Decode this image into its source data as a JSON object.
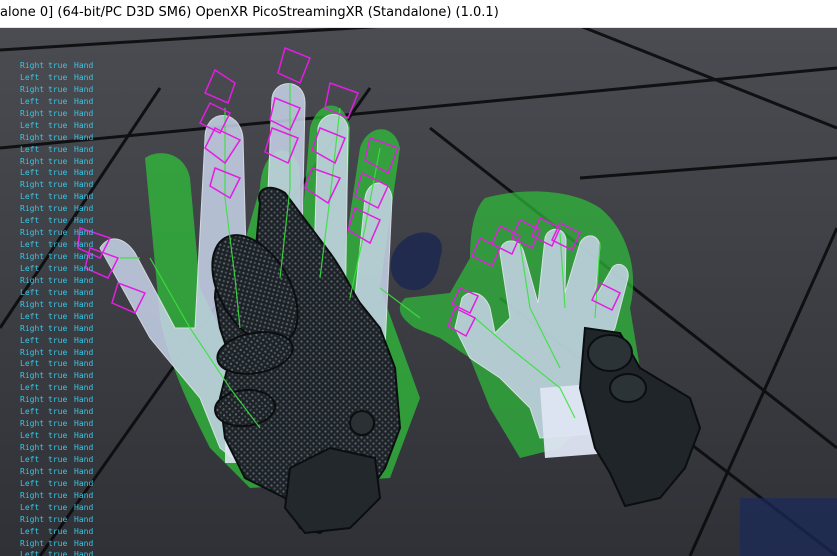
{
  "window": {
    "title": "alone 0]  (64-bit/PC D3D SM6) OpenXR  PicoStreamingXR (Standalone) (1.0.1)"
  },
  "colors": {
    "floor": "#3a3c42",
    "grid_line": "#0b0b0d",
    "hand_mesh": "#c9d4ea",
    "ghost_hand": "#2fbf3a",
    "bone_gizmo": "#e21ee0",
    "glove": "#1c2124",
    "debug_text": "#37c7e6"
  },
  "icons": {
    "hand_gizmo": "magenta-bone-diamond-icon"
  },
  "debug_log": [
    {
      "side": "Right",
      "state": "true",
      "label": "Hand"
    },
    {
      "side": "Left",
      "state": "true",
      "label": "Hand"
    },
    {
      "side": "Right",
      "state": "true",
      "label": "Hand"
    },
    {
      "side": "Left",
      "state": "true",
      "label": "Hand"
    },
    {
      "side": "Right",
      "state": "true",
      "label": "Hand"
    },
    {
      "side": "Left",
      "state": "true",
      "label": "Hand"
    },
    {
      "side": "Right",
      "state": "true",
      "label": "Hand"
    },
    {
      "side": "Left",
      "state": "true",
      "label": "Hand"
    },
    {
      "side": "Right",
      "state": "true",
      "label": "Hand"
    },
    {
      "side": "Left",
      "state": "true",
      "label": "Hand"
    },
    {
      "side": "Right",
      "state": "true",
      "label": "Hand"
    },
    {
      "side": "Left",
      "state": "true",
      "label": "Hand"
    },
    {
      "side": "Right",
      "state": "true",
      "label": "Hand"
    },
    {
      "side": "Left",
      "state": "true",
      "label": "Hand"
    },
    {
      "side": "Right",
      "state": "true",
      "label": "Hand"
    },
    {
      "side": "Left",
      "state": "true",
      "label": "Hand"
    },
    {
      "side": "Right",
      "state": "true",
      "label": "Hand"
    },
    {
      "side": "Left",
      "state": "true",
      "label": "Hand"
    },
    {
      "side": "Right",
      "state": "true",
      "label": "Hand"
    },
    {
      "side": "Left",
      "state": "true",
      "label": "Hand"
    },
    {
      "side": "Right",
      "state": "true",
      "label": "Hand"
    },
    {
      "side": "Left",
      "state": "true",
      "label": "Hand"
    },
    {
      "side": "Right",
      "state": "true",
      "label": "Hand"
    },
    {
      "side": "Left",
      "state": "true",
      "label": "Hand"
    },
    {
      "side": "Right",
      "state": "true",
      "label": "Hand"
    },
    {
      "side": "Left",
      "state": "true",
      "label": "Hand"
    },
    {
      "side": "Right",
      "state": "true",
      "label": "Hand"
    },
    {
      "side": "Left",
      "state": "true",
      "label": "Hand"
    },
    {
      "side": "Right",
      "state": "true",
      "label": "Hand"
    },
    {
      "side": "Left",
      "state": "true",
      "label": "Hand"
    },
    {
      "side": "Right",
      "state": "true",
      "label": "Hand"
    },
    {
      "side": "Left",
      "state": "true",
      "label": "Hand"
    },
    {
      "side": "Right",
      "state": "true",
      "label": "Hand"
    },
    {
      "side": "Left",
      "state": "true",
      "label": "Hand"
    },
    {
      "side": "Right",
      "state": "true",
      "label": "Hand"
    },
    {
      "side": "Left",
      "state": "true",
      "label": "Hand"
    },
    {
      "side": "Right",
      "state": "true",
      "label": "Hand"
    },
    {
      "side": "Left",
      "state": "true",
      "label": "Hand"
    },
    {
      "side": "Right",
      "state": "true",
      "label": "Hand"
    },
    {
      "side": "Left",
      "state": "true",
      "label": "Hand"
    },
    {
      "side": "Right",
      "state": "true",
      "label": "Hand"
    },
    {
      "side": "Left",
      "state": "true",
      "label": "Hand"
    },
    {
      "side": "Right",
      "state": "true",
      "label": "Hand"
    }
  ]
}
